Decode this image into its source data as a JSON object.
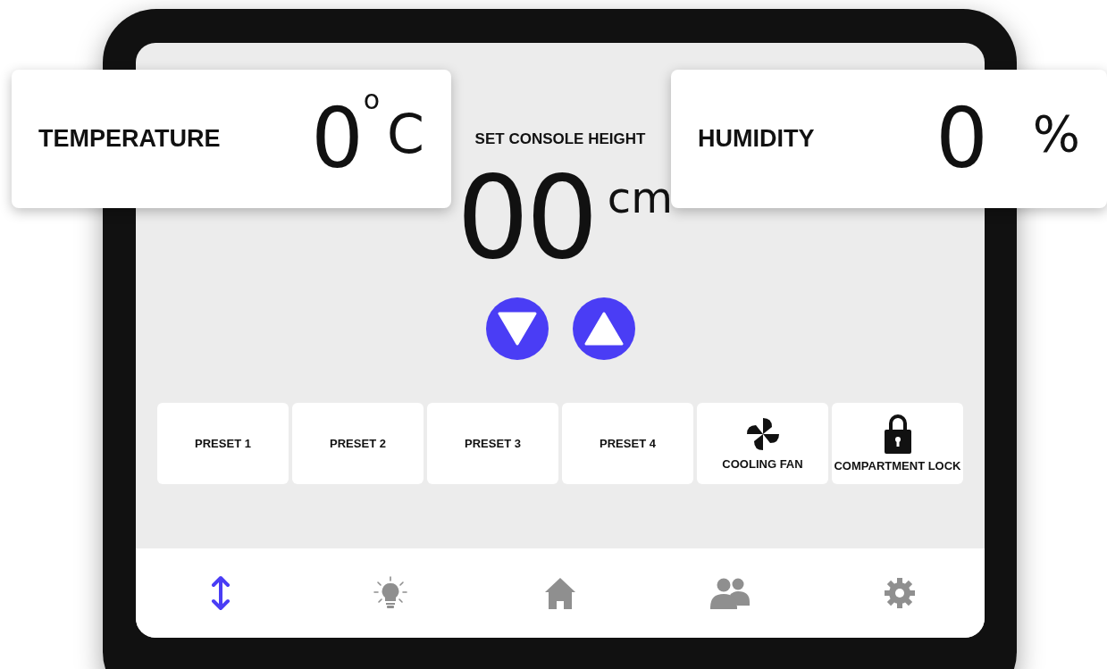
{
  "temperature": {
    "label": "TEMPERATURE",
    "value": "0",
    "degree": "o",
    "unit": "C"
  },
  "humidity": {
    "label": "HUMIDITY",
    "value": "0",
    "unit": "%"
  },
  "height": {
    "title": "SET CONSOLE HEIGHT",
    "value": "00",
    "unit": "cm"
  },
  "adjust_buttons": [
    {
      "kind": "down"
    },
    {
      "kind": "up"
    }
  ],
  "tiles": [
    {
      "kind": "preset",
      "label": "PRESET 1"
    },
    {
      "kind": "preset",
      "label": "PRESET 2"
    },
    {
      "kind": "preset",
      "label": "PRESET 3"
    },
    {
      "kind": "preset",
      "label": "PRESET 4"
    },
    {
      "kind": "fan",
      "label": "COOLING FAN"
    },
    {
      "kind": "lock",
      "label": "COMPARTMENT LOCK"
    }
  ],
  "nav": {
    "items": [
      {
        "kind": "height",
        "selected": true
      },
      {
        "kind": "light",
        "selected": false
      },
      {
        "kind": "home",
        "selected": false
      },
      {
        "kind": "users",
        "selected": false
      },
      {
        "kind": "settings",
        "selected": false
      }
    ]
  }
}
